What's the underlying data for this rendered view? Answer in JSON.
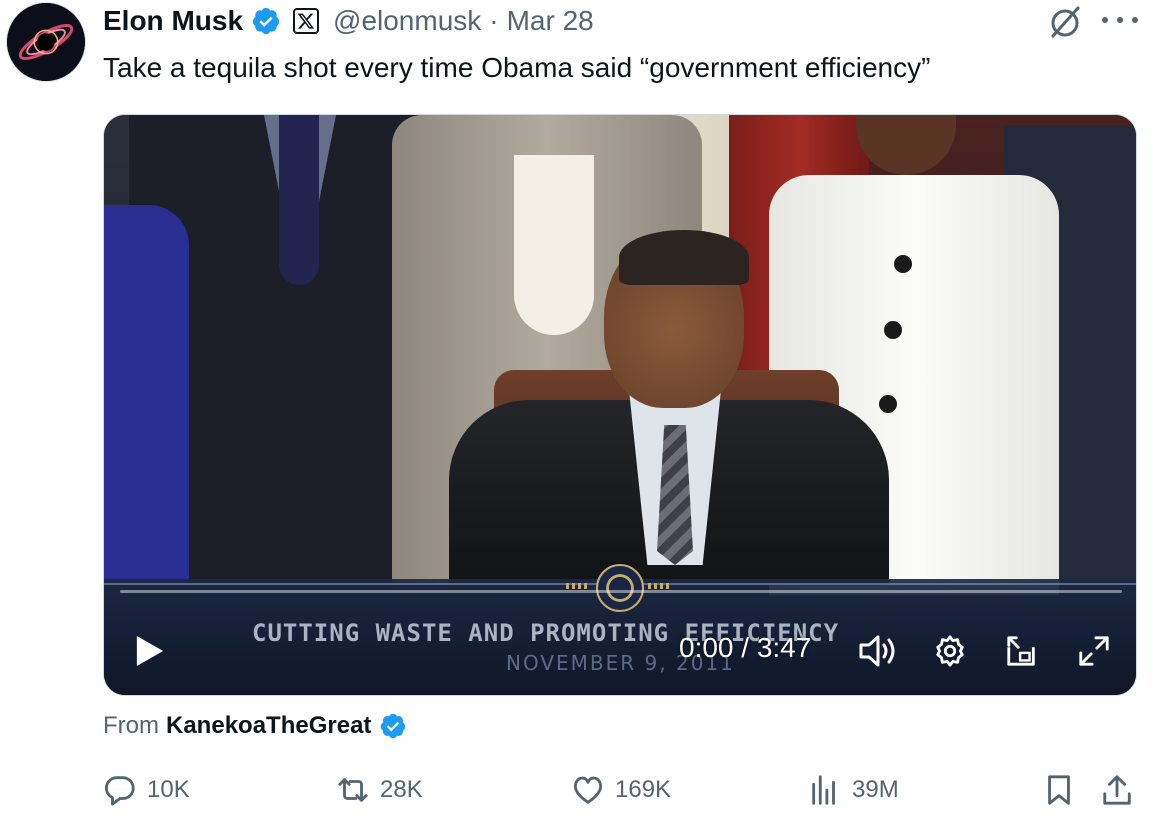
{
  "tweet": {
    "author_name": "Elon Musk",
    "handle": "@elonmusk",
    "separator": "·",
    "date": "Mar 28",
    "text": "Take a tequila shot every time Obama said “government efficiency”"
  },
  "video": {
    "banner_title": "CUTTING WASTE AND PROMOTING EFFICIENCY",
    "banner_date": "NOVEMBER 9, 2011",
    "time_display": "0:00 / 3:47",
    "progress_fraction": 0.0
  },
  "attribution": {
    "prefix": "From",
    "source": "KanekoaTheGreat"
  },
  "actions": {
    "replies": "10K",
    "reposts": "28K",
    "likes": "169K",
    "views": "39M"
  },
  "colors": {
    "verified_blue": "#1d9bf0",
    "secondary_text": "#536471",
    "primary_text": "#0f1419"
  },
  "icons": [
    "verified-badge-icon",
    "x-logo-icon",
    "grok-icon",
    "more-icon",
    "play-icon",
    "volume-icon",
    "gear-icon",
    "pip-icon",
    "fullscreen-icon",
    "reply-icon",
    "repost-icon",
    "like-icon",
    "views-icon",
    "bookmark-icon",
    "share-icon"
  ]
}
